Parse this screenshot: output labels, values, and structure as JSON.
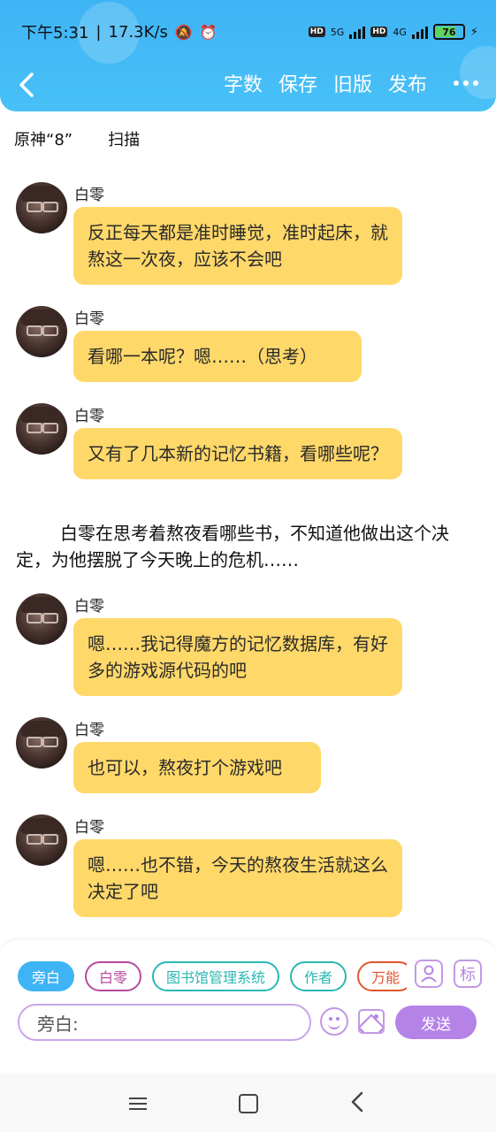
{
  "status_bar": {
    "time": "下午5:31",
    "speed": "17.3K/s",
    "net1": "5G",
    "net2": "4G",
    "hd": "HD",
    "battery": "76"
  },
  "header": {
    "actions": [
      "字数",
      "保存",
      "旧版",
      "发布"
    ]
  },
  "subbar": {
    "title": "原神“8”",
    "scan": "扫描"
  },
  "messages": [
    {
      "name": "白零",
      "text": "反正每天都是准时睡觉，准时起床，就熬这一次夜，应该不会吧"
    },
    {
      "name": "白零",
      "text": "看哪一本呢？嗯……（思考）"
    },
    {
      "name": "白零",
      "text": "又有了几本新的记忆书籍，看哪些呢？"
    },
    {
      "name": "白零",
      "text": "嗯……我记得魔方的记忆数据库，有好多的游戏源代码的吧"
    },
    {
      "name": "白零",
      "text": "也可以，熬夜打个游戏吧"
    },
    {
      "name": "白零",
      "text": "嗯……也不错，今天的熬夜生活就这么决定了吧"
    }
  ],
  "narration": "白零在思考着熬夜看哪些书，不知道他做出这个决定，为他摆脱了今天晚上的危机……",
  "composer": {
    "chips": [
      "旁白",
      "白零",
      "图书馆管理系统",
      "作者",
      "万能"
    ],
    "tag_button": "标",
    "input_placeholder": "旁白:",
    "send": "发送"
  }
}
